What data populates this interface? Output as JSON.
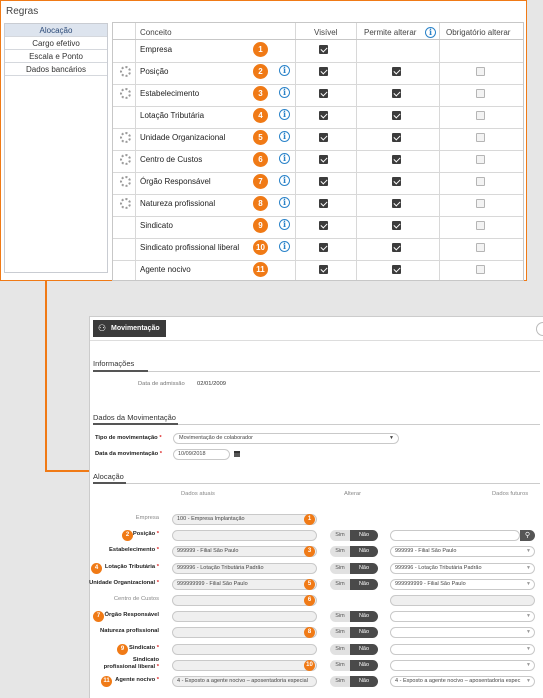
{
  "rules": {
    "title": "Regras",
    "sidebar": [
      "Alocação",
      "Cargo efetivo",
      "Escala e Ponto",
      "Dados bancários"
    ],
    "headers": {
      "concept": "Conceito",
      "visible": "Visível",
      "allow": "Permite alterar",
      "required": "Obrigatório alterar"
    },
    "rows": [
      {
        "label": "Empresa",
        "badge": "1",
        "gear": false,
        "info": false,
        "visible": true,
        "allow": false,
        "required": false
      },
      {
        "label": "Posição",
        "badge": "2",
        "gear": true,
        "info": true,
        "visible": true,
        "allow": true,
        "required": false
      },
      {
        "label": "Estabelecimento",
        "badge": "3",
        "gear": true,
        "info": true,
        "visible": true,
        "allow": true,
        "required": false
      },
      {
        "label": "Lotação Tributária",
        "badge": "4",
        "gear": false,
        "info": true,
        "visible": true,
        "allow": true,
        "required": false
      },
      {
        "label": "Unidade Organizacional",
        "badge": "5",
        "gear": true,
        "info": true,
        "visible": true,
        "allow": true,
        "required": false
      },
      {
        "label": "Centro de Custos",
        "badge": "6",
        "gear": true,
        "info": true,
        "visible": true,
        "allow": true,
        "required": false
      },
      {
        "label": "Órgão Responsável",
        "badge": "7",
        "gear": true,
        "info": true,
        "visible": true,
        "allow": true,
        "required": false
      },
      {
        "label": "Natureza profissional",
        "badge": "8",
        "gear": true,
        "info": true,
        "visible": true,
        "allow": true,
        "required": false
      },
      {
        "label": "Sindicato",
        "badge": "9",
        "gear": false,
        "info": true,
        "visible": true,
        "allow": true,
        "required": false
      },
      {
        "label": "Sindicato profissional liberal",
        "badge": "10",
        "gear": false,
        "info": true,
        "visible": true,
        "allow": true,
        "required": false
      },
      {
        "label": "Agente nocivo",
        "badge": "11",
        "gear": false,
        "info": false,
        "visible": true,
        "allow": true,
        "required": false
      }
    ]
  },
  "mov": {
    "tab": "Movimentação",
    "info_title": "Informações",
    "admission_label": "Data de admissão",
    "admission_value": "02/01/2009",
    "dados_title": "Dados da Movimentação",
    "tipo_label": "Tipo de movimentação",
    "tipo_value": "Movimentação de colaborador",
    "data_label": "Data da movimentação",
    "data_value": "10/09/2018",
    "alocacao_title": "Alocação",
    "col_atual": "Dados atuais",
    "col_alterar": "Alterar",
    "col_futuro": "Dados futuros",
    "sim": "Sim",
    "nao": "Não",
    "rows": [
      {
        "label": "Empresa",
        "req": false,
        "light": true,
        "badge": "",
        "current": "100 - Empresa Implantação",
        "cbadge": "1",
        "toggle": false,
        "future": null
      },
      {
        "label": "Posição",
        "req": true,
        "light": false,
        "badge": "2",
        "current": "",
        "cbadge": "",
        "toggle": true,
        "future": "",
        "search": true
      },
      {
        "label": "Estabelecimento",
        "req": true,
        "light": false,
        "badge": "",
        "current": "999999 - Filial São Paulo",
        "cbadge": "3",
        "toggle": true,
        "future": "999999 - Filial São Paulo"
      },
      {
        "label": "Lotação Tributária",
        "req": true,
        "light": false,
        "badge": "4",
        "current": "999996 - Lotação Tributária Padrão",
        "cbadge": "",
        "toggle": true,
        "future": "999996 - Lotação Tributária Padrão"
      },
      {
        "label": "Unidade Organizacional",
        "req": true,
        "light": false,
        "badge": "",
        "current": "999999999 - Filial São Paulo",
        "cbadge": "5",
        "toggle": true,
        "future": "999999999 - Filial São Paulo"
      },
      {
        "label": "Centro de Custos",
        "req": false,
        "light": true,
        "badge": "",
        "current": "",
        "cbadge": "6",
        "toggle": false,
        "future": "",
        "plain": true
      },
      {
        "label": "Órgão Responsável",
        "req": false,
        "light": false,
        "badge": "7",
        "current": "",
        "cbadge": "",
        "toggle": true,
        "future": ""
      },
      {
        "label": "Natureza profissional",
        "req": false,
        "light": false,
        "badge": "",
        "current": "",
        "cbadge": "8",
        "toggle": true,
        "future": ""
      },
      {
        "label": "Sindicato",
        "req": true,
        "light": false,
        "badge": "9",
        "current": "",
        "cbadge": "",
        "toggle": true,
        "future": ""
      },
      {
        "label": "Sindicato profissional liberal",
        "req": true,
        "light": false,
        "badge": "",
        "current": "",
        "cbadge": "10",
        "toggle": true,
        "future": ""
      },
      {
        "label": "Agente nocivo",
        "req": true,
        "light": false,
        "badge": "11",
        "current": "4 - Exposto a agente nocivo – aposentadoria especial",
        "cbadge": "",
        "toggle": true,
        "future": "4 - Exposto a agente nocivo – aposentadoria espec"
      }
    ]
  },
  "colors": {
    "accent": "#f07a16",
    "info": "#2a83c9",
    "frame": "#f07a16"
  }
}
